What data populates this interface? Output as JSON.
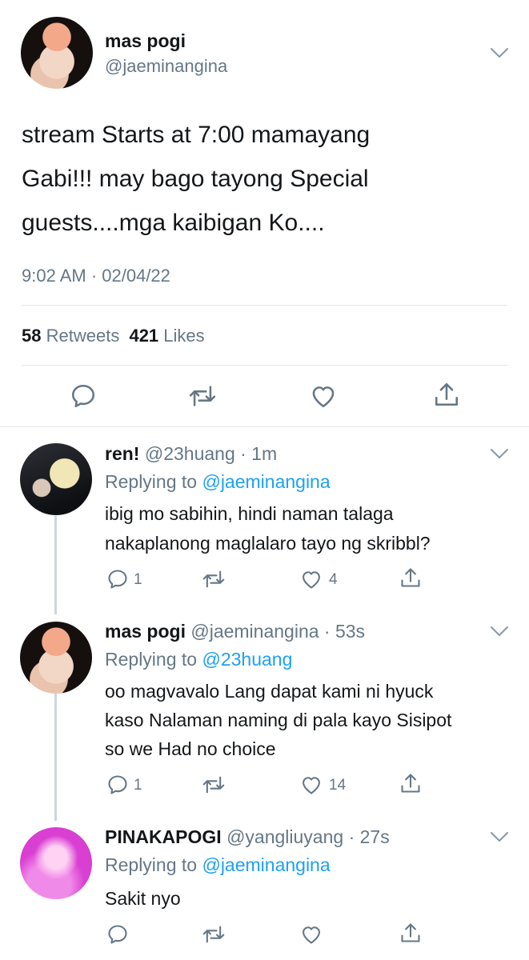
{
  "main_tweet": {
    "display_name": "mas pogi",
    "handle": "@jaeminangina",
    "text_lines": [
      "stream Starts at 7:00 mamayang",
      "Gabi!!! may bago tayong Special",
      "guests....mga kaibigan Ko...."
    ],
    "timestamp": "9:02 AM · 02/04/22",
    "retweet_count": "58",
    "retweets_label": "Retweets",
    "like_count": "421",
    "likes_label": "Likes"
  },
  "replies": [
    {
      "display_name": "ren!",
      "handle_time": "@23huang · 1m",
      "replying_prefix": "Replying to",
      "replying_handle": "@jaeminangina",
      "text_lines": [
        "ibig mo sabihin, hindi naman talaga",
        "nakaplanong maglalaro tayo ng skribbl?"
      ],
      "reply_count": "1",
      "retweet_count": "",
      "like_count": "4"
    },
    {
      "display_name": "mas pogi",
      "handle_time": "@jaeminangina · 53s",
      "replying_prefix": "Replying to",
      "replying_handle": "@23huang",
      "text_lines": [
        "oo magvavalo Lang dapat kami ni hyuck",
        "kaso Nalaman naming di pala kayo Sisipot",
        "so we Had no choice"
      ],
      "reply_count": "1",
      "retweet_count": "",
      "like_count": "14"
    },
    {
      "display_name": "PINAKAPOGI",
      "handle_time": "@yangliuyang · 27s",
      "replying_prefix": "Replying to",
      "replying_handle": "@jaeminangina",
      "text_lines": [
        "Sakit nyo"
      ],
      "reply_count": "",
      "retweet_count": "",
      "like_count": ""
    }
  ],
  "icons": {
    "reply": "reply-icon",
    "retweet": "retweet-icon",
    "like": "like-icon",
    "share": "share-icon",
    "more": "chevron-down-icon"
  },
  "colors": {
    "link": "#1da1f2",
    "secondary": "#657786",
    "divider": "#e1e8ed"
  }
}
